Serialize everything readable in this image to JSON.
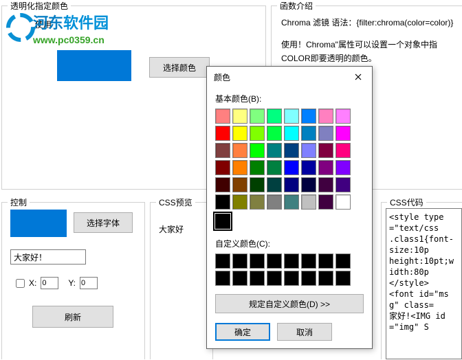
{
  "watermark": {
    "site_name": "河东软件园",
    "url": "www.pc0359.cn"
  },
  "topleft": {
    "title": "透明化指定颜色",
    "example_label": "使用",
    "choose_color": "选择颜色",
    "swatch_color": "#0078d7"
  },
  "topright": {
    "title": "函数介绍",
    "line1": "Chroma 滤镜 语法：{filter:chroma(color=color)}",
    "line2": "使用！Chroma\"属性可以设置一个对象中指\nCOLOR即要透明的颜色。"
  },
  "control": {
    "title": "控制",
    "font_button": "选择字体",
    "input_value": "大家好！",
    "x_label": "X:",
    "y_label": "Y:",
    "x_value": "0",
    "y_value": "0",
    "refresh": "刷新",
    "swatch_color": "#0078d7"
  },
  "preview": {
    "title": "CSS预览",
    "text": "大家好"
  },
  "code": {
    "title": "CSS代码",
    "content": "<style type=\"text/css\n.class1{font-size:10p\nheight:10pt;width:80p\n</style>\n<font id=\"msg\" class=\n家好!<IMG id=\"img\" S"
  },
  "color_dialog": {
    "title": "颜色",
    "basic_label": "基本颜色(B):",
    "custom_label": "自定义颜色(C):",
    "define_button": "规定自定义颜色(D) >>",
    "ok": "确定",
    "cancel": "取消",
    "basic_colors": [
      "#ff8080",
      "#ffff80",
      "#80ff80",
      "#00ff80",
      "#80ffff",
      "#0080ff",
      "#ff80c0",
      "#ff80ff",
      "#ff0000",
      "#ffff00",
      "#80ff00",
      "#00ff40",
      "#00ffff",
      "#0080c0",
      "#8080c0",
      "#ff00ff",
      "#804040",
      "#ff8040",
      "#00ff00",
      "#008080",
      "#004080",
      "#8080ff",
      "#800040",
      "#ff0080",
      "#800000",
      "#ff8000",
      "#008000",
      "#008040",
      "#0000ff",
      "#0000a0",
      "#800080",
      "#8000ff",
      "#400000",
      "#804000",
      "#004000",
      "#004040",
      "#000080",
      "#000040",
      "#400040",
      "#400080",
      "#000000",
      "#808000",
      "#808040",
      "#808080",
      "#408080",
      "#c0c0c0",
      "#400040",
      "#ffffff"
    ]
  }
}
